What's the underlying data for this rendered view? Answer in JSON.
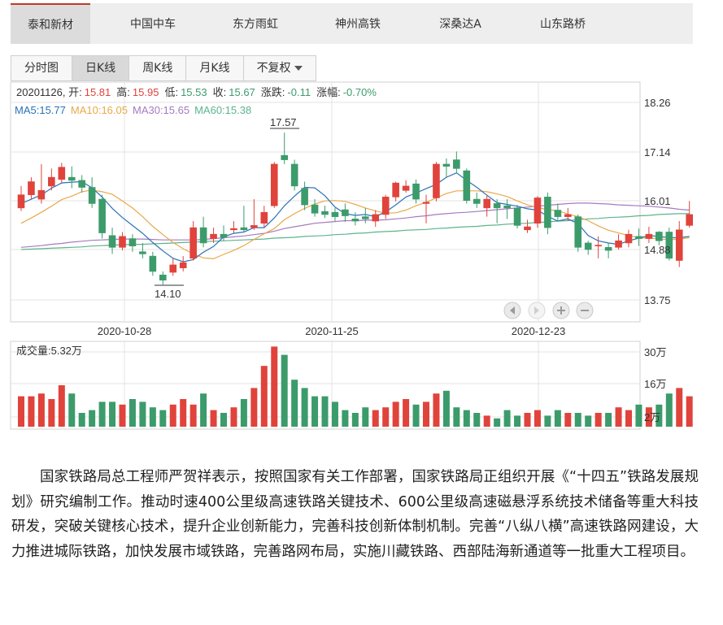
{
  "stock_tabs": [
    "泰和新材",
    "中国中车",
    "东方雨虹",
    "神州高铁",
    "深桑达A",
    "山东路桥"
  ],
  "period_tabs": [
    "分时图",
    "日K线",
    "周K线",
    "月K线",
    "不复权"
  ],
  "info": {
    "date": "20201126",
    "open_label": "开:",
    "open": "15.81",
    "high_label": "高:",
    "high": "15.95",
    "low_label": "低:",
    "low": "15.53",
    "close_label": "收:",
    "close": "15.67",
    "change_label": "涨跌:",
    "change": "-0.11",
    "pct_label": "涨幅:",
    "pct": "-0.70%"
  },
  "ma": {
    "ma5": "MA5:15.77",
    "ma10": "MA10:16.05",
    "ma30": "MA30:15.65",
    "ma60": "MA60:15.38"
  },
  "markers": {
    "max": "17.57",
    "min": "14.10"
  },
  "volume_label": "成交量:5.32万",
  "colors": {
    "up": "#e0433b",
    "down": "#3c9b6b",
    "ma5": "#2a72b8",
    "ma10": "#e8a94a",
    "ma30": "#a57bc2",
    "ma60": "#5db48c"
  },
  "chart_data": {
    "type": "candlestick",
    "y_ticks": [
      "18.26",
      "17.14",
      "16.01",
      "14.88",
      "13.75"
    ],
    "x_ticks": [
      "2020-10-28",
      "2020-11-25",
      "2020-12-23"
    ],
    "volume_ticks": [
      "30万",
      "16万",
      "2万"
    ],
    "ylim": [
      13.75,
      18.26
    ],
    "candles": [
      [
        15.85,
        16.15,
        16.35,
        15.78
      ],
      [
        16.15,
        16.45,
        16.55,
        16.05
      ],
      [
        16.05,
        16.25,
        16.85,
        15.95
      ],
      [
        16.35,
        16.55,
        16.75,
        16.25
      ],
      [
        16.5,
        16.78,
        16.88,
        16.4
      ],
      [
        16.55,
        16.48,
        16.8,
        16.3
      ],
      [
        16.48,
        16.32,
        16.6,
        16.2
      ],
      [
        16.32,
        15.95,
        16.55,
        15.85
      ],
      [
        16.05,
        15.28,
        16.15,
        15.15
      ],
      [
        15.22,
        14.95,
        15.4,
        14.8
      ],
      [
        14.95,
        15.2,
        15.3,
        14.88
      ],
      [
        15.15,
        14.98,
        15.25,
        14.85
      ],
      [
        14.85,
        14.8,
        15.05,
        14.7
      ],
      [
        14.75,
        14.4,
        14.85,
        14.3
      ],
      [
        14.32,
        14.2,
        14.4,
        14.1
      ],
      [
        14.38,
        14.55,
        14.7,
        14.3
      ],
      [
        14.48,
        14.6,
        14.75,
        14.4
      ],
      [
        14.7,
        15.4,
        15.55,
        14.65
      ],
      [
        15.4,
        15.05,
        15.65,
        14.95
      ],
      [
        15.15,
        15.25,
        15.4,
        15.05
      ],
      [
        15.25,
        15.18,
        15.45,
        15.1
      ],
      [
        15.35,
        15.38,
        15.55,
        15.28
      ],
      [
        15.4,
        15.35,
        15.9,
        15.3
      ],
      [
        15.4,
        15.45,
        16.05,
        15.35
      ],
      [
        15.5,
        15.75,
        15.9,
        15.4
      ],
      [
        15.9,
        16.85,
        16.9,
        15.85
      ],
      [
        17.05,
        16.95,
        17.57,
        16.85
      ],
      [
        16.85,
        16.35,
        16.95,
        16.25
      ],
      [
        16.3,
        15.92,
        16.45,
        15.8
      ],
      [
        15.92,
        15.73,
        16.05,
        15.65
      ],
      [
        15.77,
        15.7,
        15.9,
        15.62
      ],
      [
        15.75,
        15.65,
        15.85,
        15.55
      ],
      [
        15.81,
        15.67,
        15.95,
        15.53
      ],
      [
        15.6,
        15.55,
        15.75,
        15.45
      ],
      [
        15.65,
        15.6,
        15.85,
        15.5
      ],
      [
        15.55,
        15.7,
        15.8,
        15.42
      ],
      [
        15.7,
        16.1,
        16.15,
        15.6
      ],
      [
        16.1,
        16.42,
        16.45,
        16.0
      ],
      [
        16.25,
        16.35,
        16.48,
        16.2
      ],
      [
        16.4,
        16.05,
        16.5,
        15.95
      ],
      [
        15.95,
        15.98,
        16.15,
        15.5
      ],
      [
        16.08,
        16.85,
        16.9,
        16.0
      ],
      [
        16.85,
        16.8,
        16.98,
        16.55
      ],
      [
        16.95,
        16.75,
        17.14,
        16.65
      ],
      [
        16.7,
        16.02,
        16.75,
        15.95
      ],
      [
        16.05,
        15.95,
        16.2,
        15.85
      ],
      [
        15.85,
        16.05,
        16.15,
        15.65
      ],
      [
        15.95,
        15.85,
        16.05,
        15.5
      ],
      [
        15.9,
        15.85,
        16.05,
        15.6
      ],
      [
        15.85,
        15.45,
        15.92,
        15.38
      ],
      [
        15.35,
        15.42,
        15.58,
        15.28
      ],
      [
        15.5,
        16.08,
        16.12,
        15.4
      ],
      [
        16.1,
        15.4,
        16.2,
        15.25
      ],
      [
        15.8,
        15.65,
        15.95,
        15.55
      ],
      [
        15.65,
        15.7,
        15.85,
        15.55
      ],
      [
        15.65,
        14.95,
        15.7,
        14.85
      ],
      [
        15.05,
        14.9,
        15.1,
        14.78
      ],
      [
        14.98,
        15.0,
        15.2,
        14.7
      ],
      [
        14.95,
        14.88,
        15.05,
        14.7
      ],
      [
        14.95,
        15.1,
        15.25,
        14.9
      ],
      [
        15.05,
        15.25,
        15.35,
        14.95
      ],
      [
        15.2,
        15.15,
        15.38,
        14.98
      ],
      [
        15.15,
        15.25,
        15.42,
        15.05
      ],
      [
        15.3,
        15.1,
        15.32,
        15.0
      ],
      [
        15.3,
        14.7,
        15.4,
        14.65
      ],
      [
        14.65,
        15.35,
        15.55,
        14.5
      ],
      [
        15.45,
        15.7,
        16.01,
        15.4
      ]
    ],
    "volume": [
      11,
      11,
      12,
      10,
      15,
      12,
      5,
      6,
      9,
      9,
      8,
      10,
      9,
      7,
      6,
      8,
      10,
      8,
      12,
      6,
      5,
      7,
      10,
      14,
      22,
      29,
      26,
      17,
      14,
      11,
      11,
      9,
      6,
      5,
      7,
      6,
      7,
      9,
      10,
      8,
      9,
      12,
      13,
      7,
      6,
      5,
      4,
      3,
      6,
      4,
      5,
      6,
      4,
      6,
      5,
      5,
      4,
      5,
      5,
      7,
      6,
      8,
      7,
      8,
      12,
      14,
      11
    ],
    "ma5": [
      15.95,
      16.05,
      16.15,
      16.3,
      16.42,
      16.44,
      16.45,
      16.31,
      16.1,
      15.84,
      15.63,
      15.45,
      15.27,
      15.06,
      14.87,
      14.7,
      14.62,
      14.67,
      14.84,
      14.97,
      15.19,
      15.27,
      15.3,
      15.4,
      15.4,
      15.62,
      15.9,
      16.12,
      16.32,
      16.31,
      16.13,
      15.87,
      15.72,
      15.68,
      15.7,
      15.65,
      15.76,
      15.92,
      16.1,
      16.19,
      16.29,
      16.39,
      16.55,
      16.65,
      16.48,
      16.32,
      16.14,
      15.97,
      15.93,
      15.89,
      15.83,
      15.8,
      15.66,
      15.55,
      15.6,
      15.49,
      15.22,
      15.1,
      15.05,
      15.02,
      15.1,
      15.16,
      15.22,
      15.2,
      15.17,
      15.17,
      15.2
    ],
    "ma10": [
      15.5,
      15.62,
      15.75,
      15.89,
      16.04,
      16.12,
      16.22,
      16.26,
      16.22,
      16.16,
      16.01,
      15.85,
      15.65,
      15.43,
      15.24,
      15.06,
      14.92,
      14.8,
      14.71,
      14.69,
      14.79,
      14.88,
      14.99,
      15.13,
      15.26,
      15.38,
      15.58,
      15.72,
      15.84,
      15.94,
      16.01,
      16.02,
      16.0,
      15.93,
      15.85,
      15.78,
      15.73,
      15.74,
      15.8,
      15.9,
      15.98,
      16.08,
      16.18,
      16.24,
      16.24,
      16.24,
      16.22,
      16.17,
      16.11,
      16.01,
      15.92,
      15.86,
      15.81,
      15.79,
      15.71,
      15.65,
      15.56,
      15.44,
      15.34,
      15.28,
      15.22,
      15.17,
      15.16,
      15.15,
      15.12,
      15.14,
      15.17
    ],
    "ma30": [
      14.95,
      14.97,
      14.99,
      15.02,
      15.04,
      15.07,
      15.09,
      15.11,
      15.12,
      15.13,
      15.14,
      15.14,
      15.14,
      15.13,
      15.12,
      15.12,
      15.12,
      15.12,
      15.13,
      15.15,
      15.17,
      15.19,
      15.21,
      15.24,
      15.27,
      15.32,
      15.38,
      15.42,
      15.46,
      15.5,
      15.52,
      15.54,
      15.56,
      15.56,
      15.57,
      15.57,
      15.58,
      15.6,
      15.62,
      15.65,
      15.67,
      15.7,
      15.72,
      15.74,
      15.75,
      15.77,
      15.79,
      15.81,
      15.83,
      15.85,
      15.87,
      15.89,
      15.91,
      15.93,
      15.95,
      15.96,
      15.96,
      15.95,
      15.94,
      15.92,
      15.91,
      15.9,
      15.89,
      15.87,
      15.85,
      15.82,
      15.8
    ],
    "ma60": [
      14.9,
      14.91,
      14.92,
      14.93,
      14.94,
      14.95,
      14.96,
      14.98,
      14.99,
      15.0,
      15.01,
      15.02,
      15.02,
      15.03,
      15.04,
      15.05,
      15.06,
      15.07,
      15.08,
      15.09,
      15.1,
      15.11,
      15.12,
      15.13,
      15.14,
      15.16,
      15.17,
      15.18,
      15.2,
      15.21,
      15.22,
      15.24,
      15.25,
      15.27,
      15.28,
      15.3,
      15.31,
      15.32,
      15.34,
      15.35,
      15.36,
      15.38,
      15.39,
      15.41,
      15.42,
      15.43,
      15.45,
      15.46,
      15.48,
      15.49,
      15.5,
      15.52,
      15.53,
      15.55,
      15.56,
      15.58,
      15.6,
      15.61,
      15.63,
      15.64,
      15.65,
      15.67,
      15.68,
      15.7,
      15.71,
      15.72,
      15.72
    ]
  },
  "article": "国家铁路局总工程师严贺祥表示，按照国家有关工作部署，国家铁路局正组织开展《“十四五”铁路发展规划》研究编制工作。推动时速400公里级高速铁路关键技术、600公里级高速磁悬浮系统技术储备等重大科技研发，突破关键核心技术，提升企业创新能力，完善科技创新体制机制。完善“八纵八横”高速铁路网建设，大力推进城际铁路，加快发展市域铁路，完善路网布局，实施川藏铁路、西部陆海新通道等一批重大工程项目。"
}
